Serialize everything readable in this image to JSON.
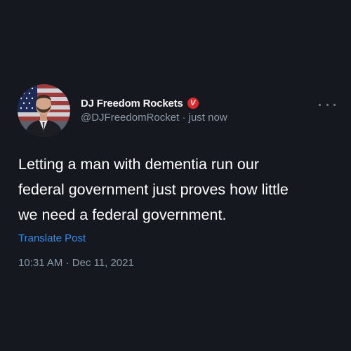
{
  "tweet": {
    "display_name": "DJ Freedom Rockets",
    "badge_letter": "V",
    "badge_color": "#e1262c",
    "handle": "@DJFreedomRocket",
    "separator": "·",
    "relative_time": "just now",
    "text_lines": [
      "Letting a man with dementia run our",
      "federal government just proves how little",
      "we need a federal government."
    ],
    "translate_label": "Translate Post",
    "timestamp": "10:31 AM · Dec 11, 2021",
    "more_icon": "more-horizontal-icon"
  },
  "colors": {
    "background": "#15181f",
    "text": "#ffffff",
    "muted": "#8b98a5",
    "link": "#2f8ff0"
  }
}
